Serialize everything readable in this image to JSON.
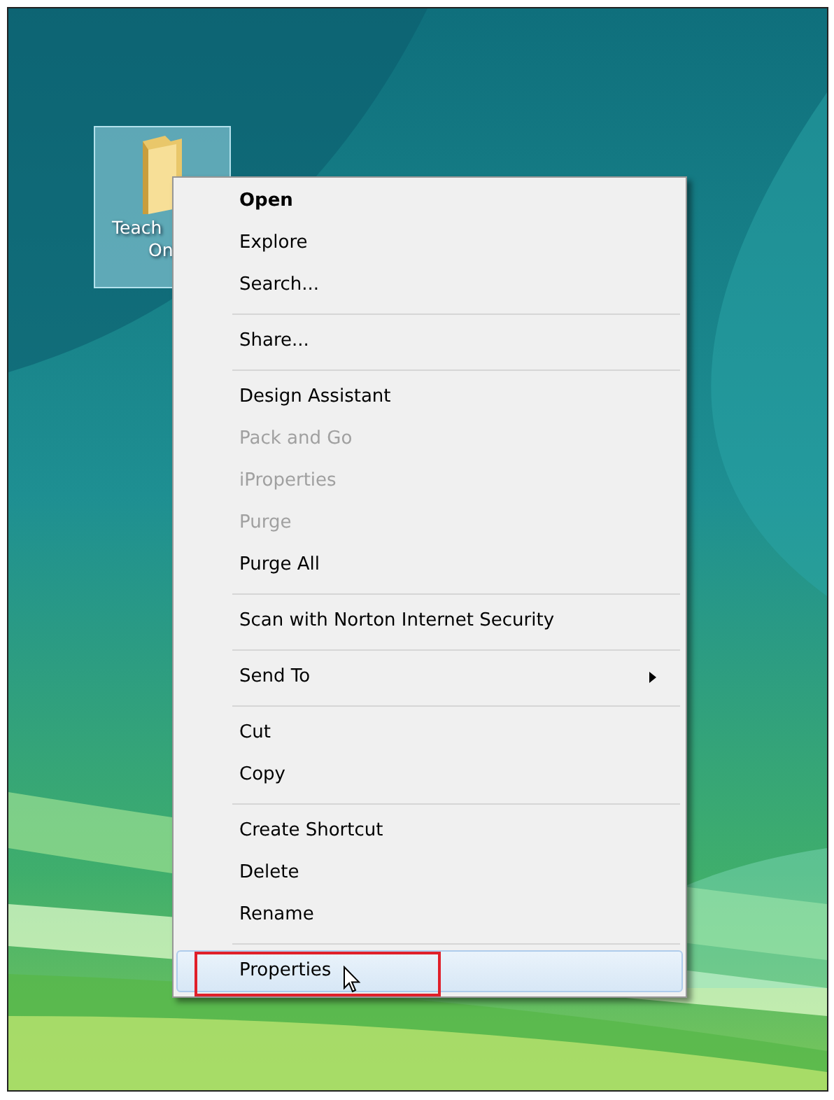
{
  "desktop_icon": {
    "label_lines": [
      "Teach",
      "On"
    ],
    "selected": true
  },
  "context_menu": {
    "groups": [
      [
        {
          "label": "Open",
          "bold": true,
          "disabled": false,
          "submenu": false,
          "selected": false,
          "annotated": false
        },
        {
          "label": "Explore",
          "bold": false,
          "disabled": false,
          "submenu": false,
          "selected": false,
          "annotated": false
        },
        {
          "label": "Search...",
          "bold": false,
          "disabled": false,
          "submenu": false,
          "selected": false,
          "annotated": false
        }
      ],
      [
        {
          "label": "Share...",
          "bold": false,
          "disabled": false,
          "submenu": false,
          "selected": false,
          "annotated": false
        }
      ],
      [
        {
          "label": "Design Assistant",
          "bold": false,
          "disabled": false,
          "submenu": false,
          "selected": false,
          "annotated": false
        },
        {
          "label": "Pack and Go",
          "bold": false,
          "disabled": true,
          "submenu": false,
          "selected": false,
          "annotated": false
        },
        {
          "label": "iProperties",
          "bold": false,
          "disabled": true,
          "submenu": false,
          "selected": false,
          "annotated": false
        },
        {
          "label": "Purge",
          "bold": false,
          "disabled": true,
          "submenu": false,
          "selected": false,
          "annotated": false
        },
        {
          "label": "Purge All",
          "bold": false,
          "disabled": false,
          "submenu": false,
          "selected": false,
          "annotated": false
        }
      ],
      [
        {
          "label": "Scan with Norton Internet Security",
          "bold": false,
          "disabled": false,
          "submenu": false,
          "selected": false,
          "annotated": false
        }
      ],
      [
        {
          "label": "Send To",
          "bold": false,
          "disabled": false,
          "submenu": true,
          "selected": false,
          "annotated": false
        }
      ],
      [
        {
          "label": "Cut",
          "bold": false,
          "disabled": false,
          "submenu": false,
          "selected": false,
          "annotated": false
        },
        {
          "label": "Copy",
          "bold": false,
          "disabled": false,
          "submenu": false,
          "selected": false,
          "annotated": false
        }
      ],
      [
        {
          "label": "Create Shortcut",
          "bold": false,
          "disabled": false,
          "submenu": false,
          "selected": false,
          "annotated": false
        },
        {
          "label": "Delete",
          "bold": false,
          "disabled": false,
          "submenu": false,
          "selected": false,
          "annotated": false
        },
        {
          "label": "Rename",
          "bold": false,
          "disabled": false,
          "submenu": false,
          "selected": false,
          "annotated": false
        }
      ],
      [
        {
          "label": "Properties",
          "bold": false,
          "disabled": false,
          "submenu": false,
          "selected": true,
          "annotated": true
        }
      ]
    ]
  }
}
